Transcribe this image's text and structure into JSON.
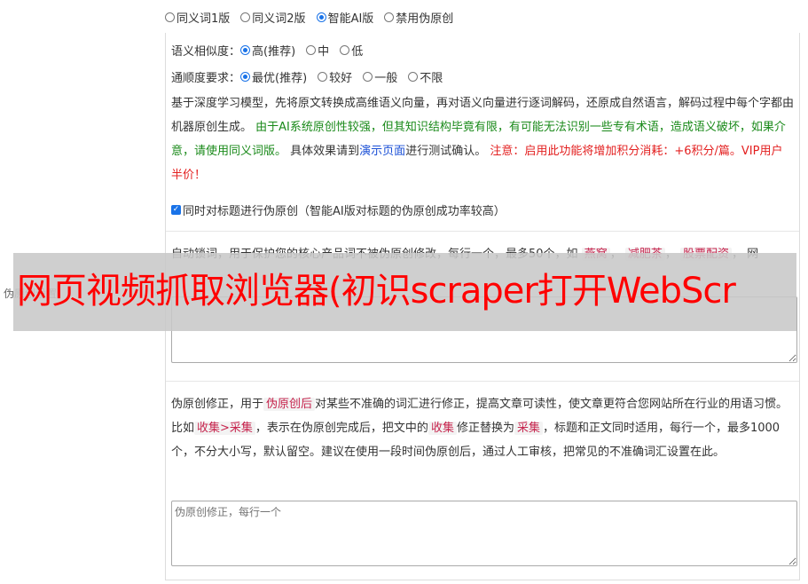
{
  "modes": [
    {
      "label": "同义词1版",
      "checked": false
    },
    {
      "label": "同义词2版",
      "checked": false
    },
    {
      "label": "智能AI版",
      "checked": true
    },
    {
      "label": "禁用伪原创",
      "checked": false
    }
  ],
  "similarity": {
    "label": "语义相似度：",
    "options": [
      {
        "label": "高(推荐)",
        "checked": true
      },
      {
        "label": "中",
        "checked": false
      },
      {
        "label": "低",
        "checked": false
      }
    ]
  },
  "fluency": {
    "label": "通顺度要求：",
    "options": [
      {
        "label": "最优(推荐)",
        "checked": true
      },
      {
        "label": "较好",
        "checked": false
      },
      {
        "label": "一般",
        "checked": false
      },
      {
        "label": "不限",
        "checked": false
      }
    ]
  },
  "desc": {
    "p1": "基于深度学习模型，先将原文转换成高维语义向量，再对语义向量进行逐词解码，还原成自然语言，解码过程中每个字都由机器原创生成。",
    "green": "由于AI系统原创性较强，但其知识结构毕竟有限，有可能无法识别一些专有术语，造成语义破坏，如果介意，请使用同义词版。",
    "p2": "具体效果请到",
    "link": "演示页面",
    "p3": "进行测试确认。",
    "red": "注意：启用此功能将增加积分消耗：+6积分/篇。VIP用户半价！"
  },
  "title_check": {
    "label": "同时对标题进行伪原创（智能AI版对标题的伪原创成功率较高）",
    "checked": true
  },
  "lock": {
    "text1": "自动锁词，用于保护您的核心产品词不被伪原创修改，每行一个，最多50个，如",
    "tags": [
      "燕窝",
      "减肥茶",
      "股票配资"
    ],
    "tail": "网"
  },
  "side_label": "伪原创设置",
  "fix": {
    "t1": "伪原创修正，用于",
    "tag1": "伪原创后",
    "t2": "对某些不准确的词汇进行修正，提高文章可读性，使文章更符合您网站所在行业的用语习惯。比如",
    "tag2": "收集>采集",
    "t3": "，表示在伪原创完成后，把文中的",
    "tag3": "收集",
    "t4": "修正替换为",
    "tag4": "采集",
    "t5": "，标题和正文同时适用，每行一个，最多1000个，不分大小写，默认留空。建议在使用一段时间伪原创后，通过人工审核，把常见的不准确词汇设置在此。",
    "placeholder": "伪原创修正，每行一个"
  },
  "overlay_text": "网页视频抓取浏览器(初识scraper打开WebScr"
}
